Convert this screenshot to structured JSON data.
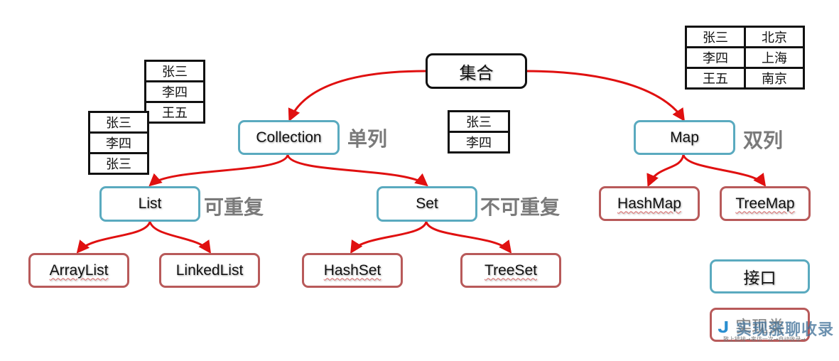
{
  "diagram": {
    "root": {
      "label": "集合"
    },
    "interfaces": {
      "collection": {
        "label": "Collection",
        "tag": "单列"
      },
      "map": {
        "label": "Map",
        "tag": "双列"
      },
      "list": {
        "label": "List",
        "tag": "可重复"
      },
      "set": {
        "label": "Set",
        "tag": "不可重复"
      }
    },
    "implementations": {
      "arraylist": {
        "label": "ArrayList"
      },
      "linkedlist": {
        "label": "LinkedList"
      },
      "hashset": {
        "label": "HashSet"
      },
      "treeset": {
        "label": "TreeSet"
      },
      "hashmap": {
        "label": "HashMap"
      },
      "treemap": {
        "label": "TreeMap"
      }
    },
    "edges": [
      {
        "from": "集合",
        "to": "Collection"
      },
      {
        "from": "集合",
        "to": "Map"
      },
      {
        "from": "Collection",
        "to": "List"
      },
      {
        "from": "Collection",
        "to": "Set"
      },
      {
        "from": "List",
        "to": "ArrayList"
      },
      {
        "from": "List",
        "to": "LinkedList"
      },
      {
        "from": "Set",
        "to": "HashSet"
      },
      {
        "from": "Set",
        "to": "TreeSet"
      },
      {
        "from": "Map",
        "to": "HashMap"
      },
      {
        "from": "Map",
        "to": "TreeMap"
      }
    ],
    "edge_color": "#e01010",
    "interface_border_color": "#5aaabf",
    "implementation_border_color": "#b85a5a"
  },
  "tables": {
    "stack_back": [
      "张三",
      "李四",
      "王五"
    ],
    "stack_front": [
      "张三",
      "李四",
      "张三"
    ],
    "set_example": [
      "张三",
      "李四"
    ],
    "map_example": [
      [
        "张三",
        "北京"
      ],
      [
        "李四",
        "上海"
      ],
      [
        "王五",
        "南京"
      ]
    ]
  },
  "legend": {
    "interface_label": "接口",
    "implementation_label": "实现类"
  },
  "watermark": {
    "title": "实现涨聊收录",
    "subtitle": "致上链接→来访一次→自动收录→"
  }
}
